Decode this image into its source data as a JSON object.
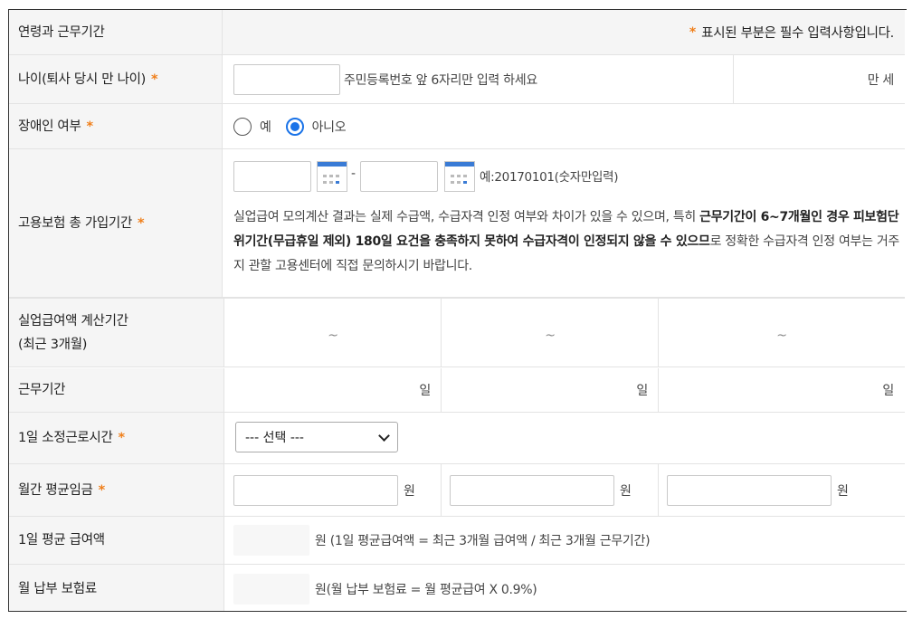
{
  "header": {
    "label": "연령과 근무기간",
    "required_notice": "표시된 부분은 필수 입력사항입니다."
  },
  "age": {
    "label": "나이(퇴사 당시 만 나이)",
    "hint": "주민등록번호 앞 6자리만 입력 하세요",
    "unit": "만 세",
    "value": ""
  },
  "disability": {
    "label": "장애인 여부",
    "options": [
      "예",
      "아니오"
    ],
    "selected": "아니오"
  },
  "insurance": {
    "label": "고용보험 총 가입기간",
    "from": "",
    "to": "",
    "sep": "-",
    "hint": "예:20170101(숫자만입력)",
    "notice_1": "실업급여 모의계산 결과는 실제 수급액, 수급자격 인정 여부와 차이가 있을 수 있으며, 특히",
    "notice_bold": "근무기간이 6~7개월인 경우 피보험단위기간(무급휴일 제외) 180일 요건을 충족하지 못하여 수급자격이 인정되지 않을 수 있으므",
    "notice_2": "로 정확한 수급자격 인정 여부는 거주지 관할 고용센터에 직접 문의하시기 바랍니다."
  },
  "calc_period": {
    "label_1": "실업급여액 계산기간",
    "label_2": "(최근 3개월)",
    "cells": [
      "~",
      "~",
      "~"
    ]
  },
  "work_period": {
    "label": "근무기간",
    "unit": "일"
  },
  "hours": {
    "label": "1일 소정근로시간",
    "selected": "--- 선택 ---"
  },
  "wage": {
    "label": "월간 평균임금",
    "unit": "원"
  },
  "daily_benefit": {
    "label": "1일 평균 급여액",
    "formula": "원 (1일 평균급여액 = 최근 3개월 급여액 / 최근 3개월 근무기간)"
  },
  "premium": {
    "label": "월 납부 보험료",
    "formula": "원(월 납부 보험료 = 월 평균급여 X 0.9%)"
  },
  "colors": {
    "accent": "#f07f1a",
    "radio": "#1a73e8",
    "calendar": "#3a7bd5"
  }
}
